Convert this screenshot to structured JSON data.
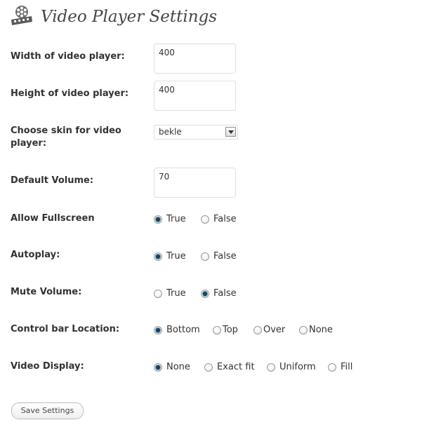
{
  "page": {
    "title": "Video Player Settings",
    "icon": "film-reel-icon"
  },
  "fields": {
    "width": {
      "label": "Width of video player:",
      "value": "400"
    },
    "height": {
      "label": "Height of video player:",
      "value": "400"
    },
    "skin": {
      "label": "Choose skin for video player:",
      "selected": "bekle"
    },
    "volume": {
      "label": "Default Volume:",
      "value": "70"
    },
    "fullscreen": {
      "label": "Allow Fullscreen",
      "options": [
        "True",
        "False"
      ],
      "selected": "True"
    },
    "autoplay": {
      "label": "Autoplay:",
      "options": [
        "True",
        "False"
      ],
      "selected": "True"
    },
    "mute": {
      "label": "Mute Volume:",
      "options": [
        "True",
        "False"
      ],
      "selected": "False"
    },
    "controlbar": {
      "label": "Control bar Location:",
      "options": [
        "Bottom",
        "Top",
        "Over",
        "None"
      ],
      "selected": "Bottom"
    },
    "display": {
      "label": "Video Display:",
      "options": [
        "None",
        "Exact fit",
        "Uniform",
        "Fill"
      ],
      "selected": "None"
    }
  },
  "actions": {
    "save_label": "Save Settings"
  },
  "colors": {
    "radio_checked": "#17435e",
    "title_text": "#464646",
    "label_text": "#333333"
  }
}
